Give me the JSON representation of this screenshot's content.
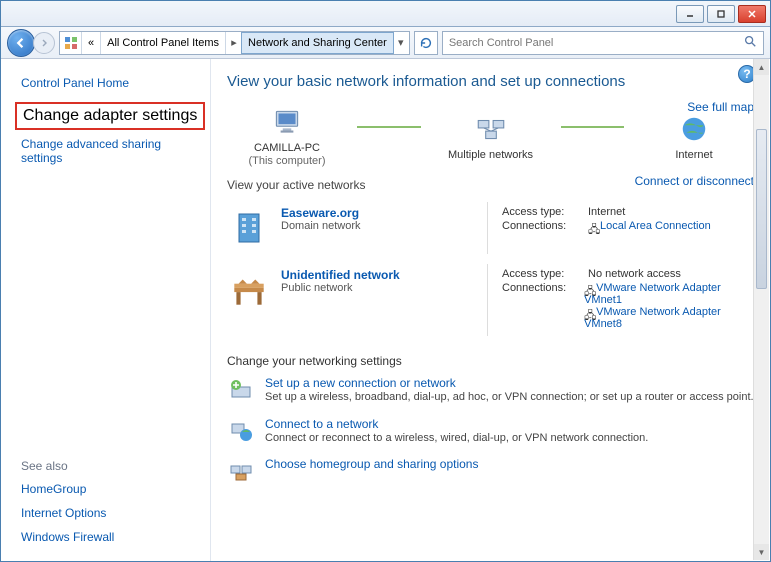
{
  "titlebar": {},
  "breadcrumb": {
    "back_separator": "«",
    "item1": "All Control Panel Items",
    "item2": "Network and Sharing Center"
  },
  "search": {
    "placeholder": "Search Control Panel"
  },
  "sidebar": {
    "home": "Control Panel Home",
    "change_adapter": "Change adapter settings",
    "change_advanced": "Change advanced sharing settings",
    "see_also_heading": "See also",
    "homegroup": "HomeGroup",
    "internet_options": "Internet Options",
    "windows_firewall": "Windows Firewall"
  },
  "main": {
    "title": "View your basic network information and set up connections",
    "see_full_map": "See full map",
    "map": {
      "pc_name": "CAMILLA-PC",
      "pc_sub": "(This computer)",
      "multi": "Multiple networks",
      "internet": "Internet"
    },
    "active_label": "View your active networks",
    "connect_link": "Connect or disconnect",
    "net1": {
      "name": "Easeware.org",
      "type": "Domain network",
      "access_label": "Access type:",
      "access_value": "Internet",
      "conn_label": "Connections:",
      "conn_link": "Local Area Connection"
    },
    "net2": {
      "name": "Unidentified network",
      "type": "Public network",
      "access_label": "Access type:",
      "access_value": "No network access",
      "conn_label": "Connections:",
      "conn_link1": "VMware Network Adapter VMnet1",
      "conn_link2": "VMware Network Adapter VMnet8"
    },
    "settings_heading": "Change your networking settings",
    "s1_title": "Set up a new connection or network",
    "s1_desc": "Set up a wireless, broadband, dial-up, ad hoc, or VPN connection; or set up a router or access point.",
    "s2_title": "Connect to a network",
    "s2_desc": "Connect or reconnect to a wireless, wired, dial-up, or VPN network connection.",
    "s3_title": "Choose homegroup and sharing options"
  }
}
